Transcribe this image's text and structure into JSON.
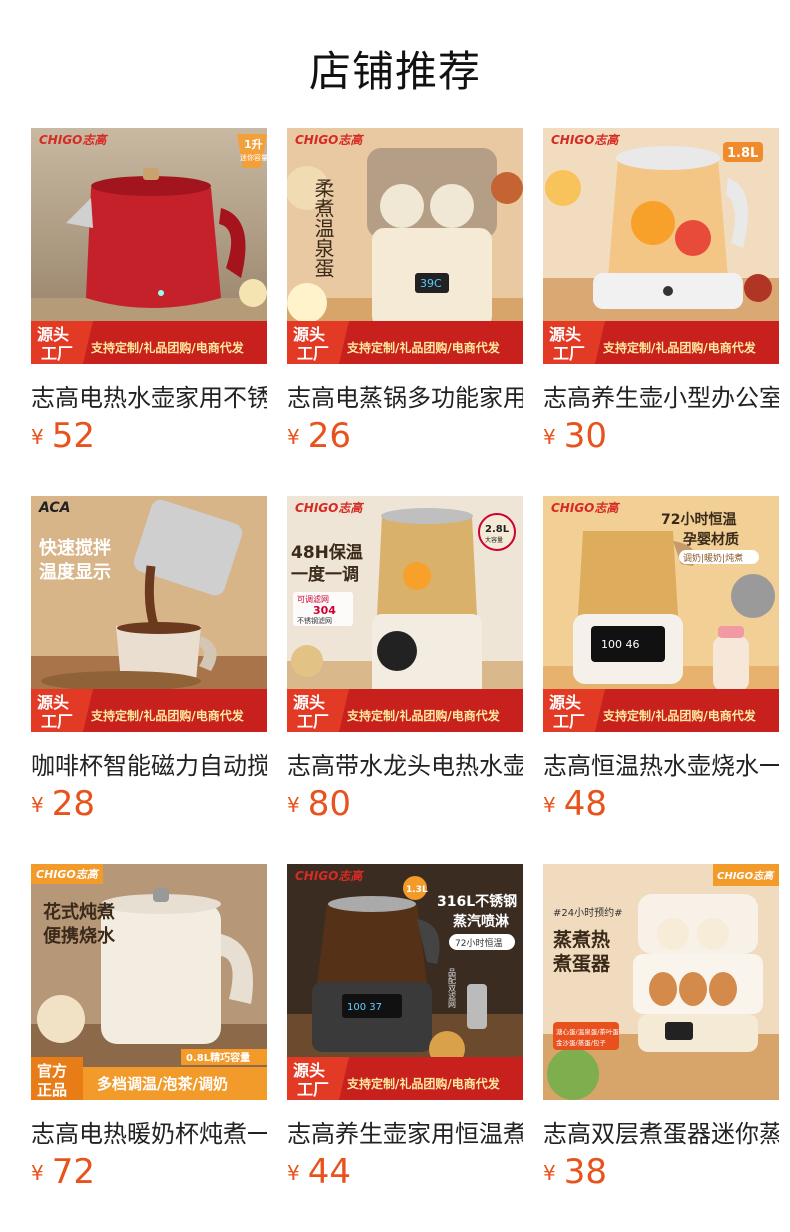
{
  "page": {
    "title": "店铺推荐"
  },
  "currency": "¥",
  "banner": {
    "factory": [
      "源头",
      "工厂"
    ],
    "services": "支持定制/礼品团购/电商代发",
    "official": [
      "官方",
      "正品"
    ]
  },
  "brand": {
    "logo": "CHIGO志高"
  },
  "products": [
    {
      "name": "志高电热水壶家用不锈钢",
      "price": "52",
      "badge": [
        "1升",
        "迷你容量"
      ]
    },
    {
      "name": "志高电蒸锅多功能家用",
      "price": "26",
      "vertical_text": "柔煮温泉蛋",
      "display": "39C"
    },
    {
      "name": "志高养生壶小型办公室",
      "price": "30",
      "badge": [
        "1.8L"
      ]
    },
    {
      "name": "咖啡杯智能磁力自动搅拌",
      "price": "28",
      "brand_logo": "ACA",
      "headline": [
        "快速搅拌",
        "温度显示"
      ]
    },
    {
      "name": "志高带水龙头电热水壶",
      "price": "80",
      "headline": [
        "48H保温",
        "一度一调"
      ],
      "tag": [
        "可调滤网",
        "304",
        "不锈钢滤网"
      ],
      "badge": [
        "2.8L",
        "大容量"
      ]
    },
    {
      "name": "志高恒温热水壶烧水一体",
      "price": "48",
      "headline": [
        "72小时恒温",
        "孕婴材质"
      ],
      "subline": "调奶|暖奶|炖煮",
      "display": "100 46"
    },
    {
      "name": "志高电热暖奶杯炖煮一体",
      "price": "72",
      "headline": [
        "花式炖煮",
        "便携烧水"
      ],
      "capacity": "0.8L精巧容量",
      "services": "多档调温/泡茶/调奶"
    },
    {
      "name": "志高养生壶家用恒温煮茶",
      "price": "44",
      "headline": [
        "316L不锈钢",
        "蒸汽喷淋",
        "72小时恒温"
      ],
      "badge": [
        "1.3L"
      ],
      "display": "100 37",
      "side_text": "品配双滤网"
    },
    {
      "name": "志高双层煮蛋器迷你蒸蛋",
      "price": "38",
      "tagline": "#24小时预约#",
      "headline": [
        "蒸煮热",
        "煮蛋器"
      ],
      "subline": [
        "溏心蛋/温泉蛋/茶叶蛋",
        "金沙蛋/蒸蛋/包子"
      ]
    }
  ]
}
